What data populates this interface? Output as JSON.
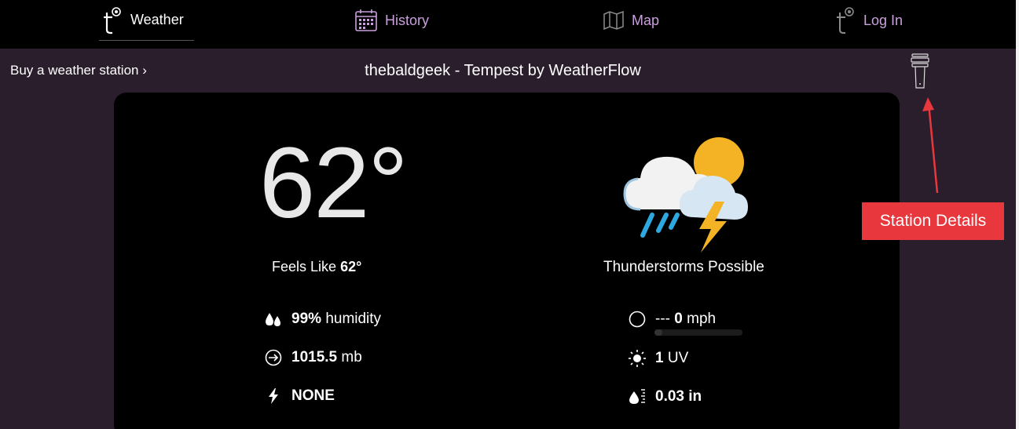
{
  "nav": {
    "weather": "Weather",
    "history": "History",
    "map": "Map",
    "login": "Log In"
  },
  "subbar": {
    "buy_link": "Buy a weather station",
    "station_title": "thebaldgeek - Tempest by WeatherFlow"
  },
  "current": {
    "temperature": "62°",
    "feels_label": "Feels Like",
    "feels_value": "62°",
    "condition": "Thunderstorms Possible"
  },
  "stats": {
    "humidity_value": "99%",
    "humidity_label": "humidity",
    "pressure_value": "1015.5",
    "pressure_unit": "mb",
    "lightning_value": "NONE",
    "wind_dir": "---",
    "wind_speed": "0",
    "wind_unit": "mph",
    "uv_value": "1",
    "uv_label": "UV",
    "rain_value": "0.03 in"
  },
  "annotation": {
    "label": "Station Details",
    "color": "#e8373d"
  },
  "colors": {
    "nav_bg": "#000000",
    "subbar_bg": "#2a1d2c",
    "nav_inactive": "#c9a0dc",
    "card_bg": "#000000"
  }
}
